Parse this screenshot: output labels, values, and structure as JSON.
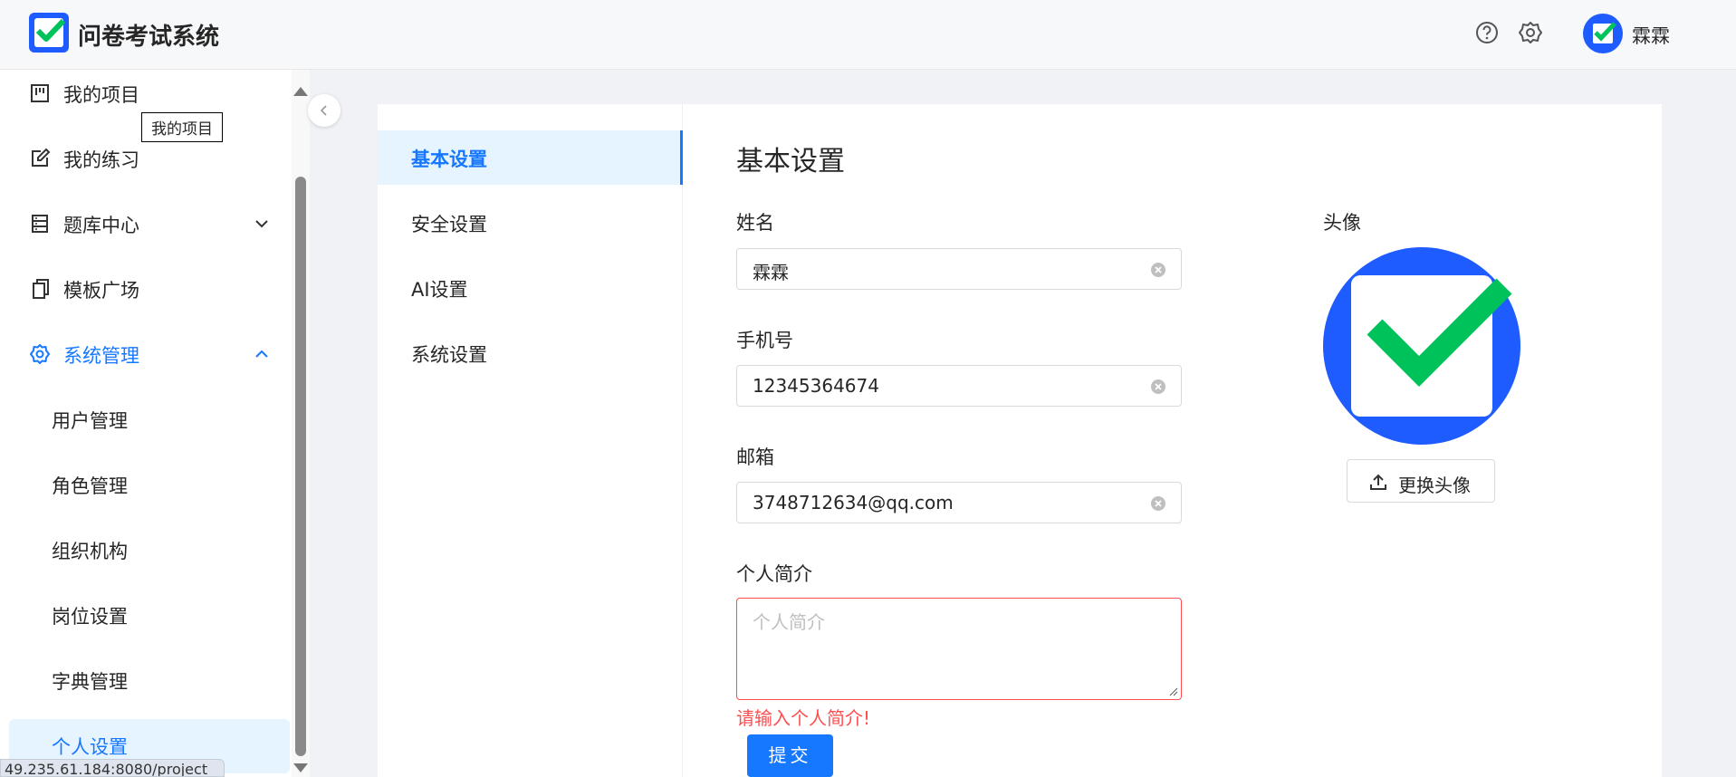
{
  "app": {
    "title": "问卷考试系统",
    "user_name": "霖霖"
  },
  "colors": {
    "accent": "#1677ff",
    "error": "#ff4d4f",
    "logo_green": "#00c25b"
  },
  "sidebar": {
    "items": [
      {
        "label": "我的项目",
        "icon": "project-board-icon"
      },
      {
        "label": "我的练习",
        "icon": "edit-icon"
      },
      {
        "label": "题库中心",
        "icon": "database-icon",
        "expandable": true
      },
      {
        "label": "模板广场",
        "icon": "copy-icon"
      },
      {
        "label": "系统管理",
        "icon": "gear-icon",
        "expanded": true,
        "active": true
      }
    ],
    "sub_items": [
      {
        "label": "用户管理"
      },
      {
        "label": "角色管理"
      },
      {
        "label": "组织机构"
      },
      {
        "label": "岗位设置"
      },
      {
        "label": "字典管理"
      },
      {
        "label": "个人设置",
        "selected": true
      }
    ],
    "tooltip": "我的项目"
  },
  "status_url": "49.235.61.184:8080/project",
  "settings_nav": [
    {
      "label": "基本设置",
      "active": true
    },
    {
      "label": "安全设置"
    },
    {
      "label": "AI设置"
    },
    {
      "label": "系统设置"
    }
  ],
  "form": {
    "title": "基本设置",
    "name_label": "姓名",
    "name_value": "霖霖",
    "phone_label": "手机号",
    "phone_value": "12345364674",
    "email_label": "邮箱",
    "email_value": "3748712634@qq.com",
    "bio_label": "个人简介",
    "bio_placeholder": "个人简介",
    "bio_error": "请输入个人简介!",
    "submit_label": "提交",
    "avatar_label": "头像",
    "upload_label": "更换头像"
  }
}
